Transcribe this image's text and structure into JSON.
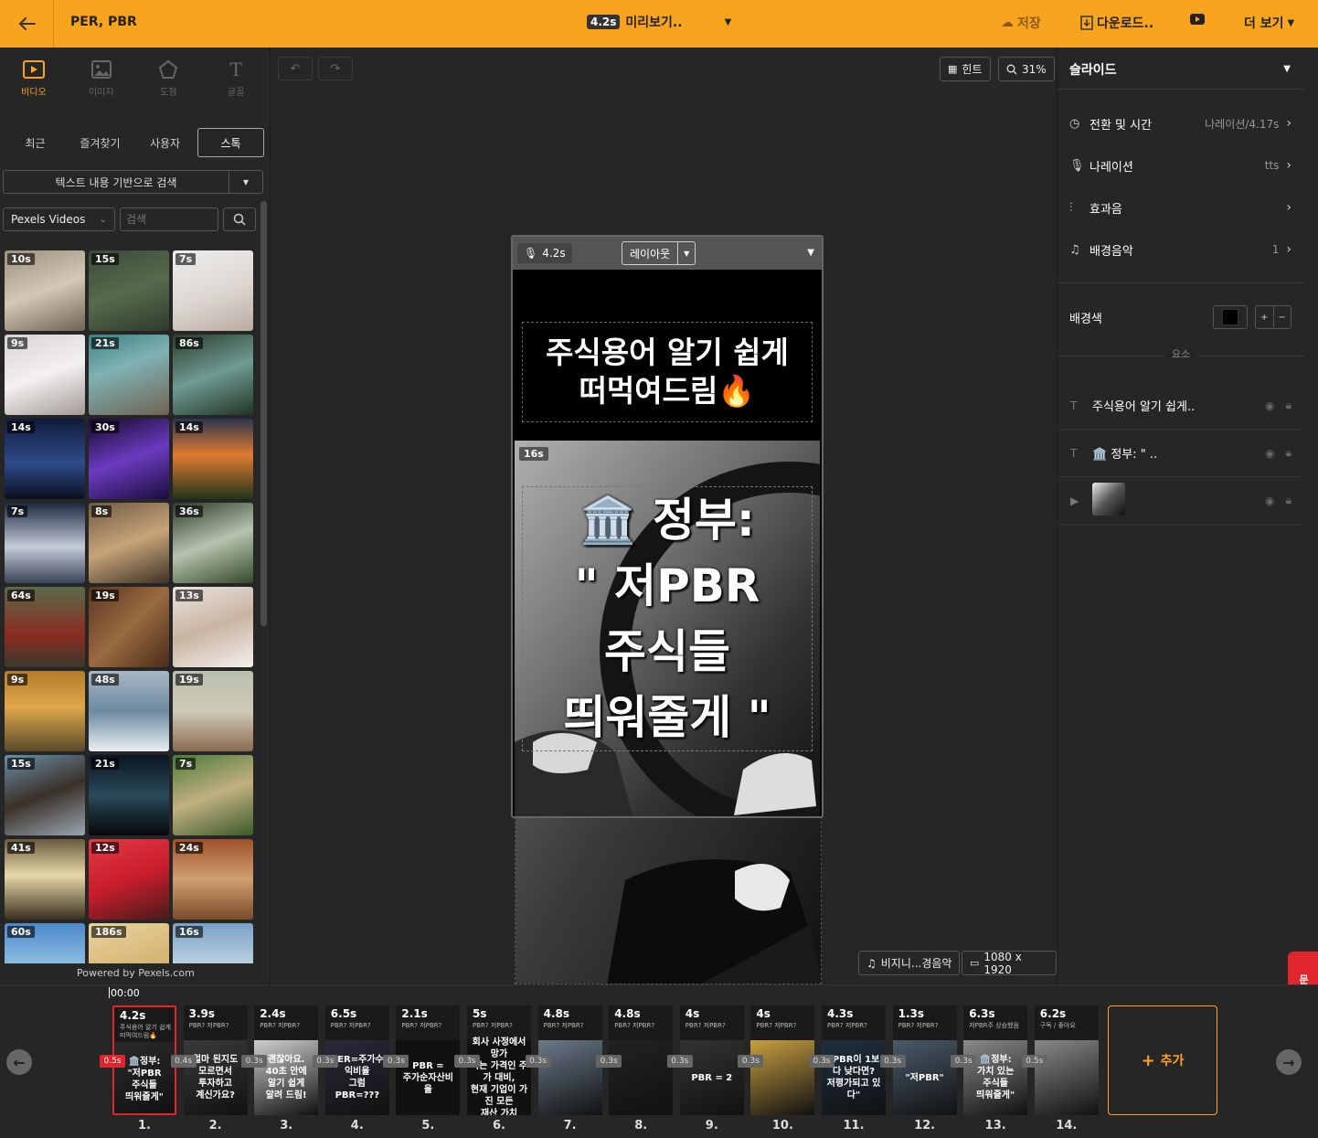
{
  "topbar": {
    "project_title": "PER, PBR",
    "preview_duration": "4.2s",
    "preview_label": "미리보기..",
    "save_label": "저장",
    "download_label": "다운로드..",
    "more_label": "더 보기",
    "accent_color": "#f8a41e"
  },
  "left": {
    "media_tabs": [
      {
        "label": "비디오",
        "icon": "video-icon"
      },
      {
        "label": "이미지",
        "icon": "image-icon"
      },
      {
        "label": "도형",
        "icon": "shape-icon"
      },
      {
        "label": "글꼴",
        "icon": "text-icon"
      }
    ],
    "source_tabs": [
      "최근",
      "즐겨찾기",
      "사용자",
      "스톡"
    ],
    "search_mode": "텍스트 내용 기반으로 검색",
    "provider": "Pexels Videos",
    "search_placeholder": "검색",
    "videos": [
      {
        "dur": "10s",
        "bg": "linear-gradient(160deg,#9b8f7e,#d3c8b5 50%,#6f6455)"
      },
      {
        "dur": "15s",
        "bg": "linear-gradient(160deg,#3b4a3a,#566b4c 50%,#2e3a2c)"
      },
      {
        "dur": "7s",
        "bg": "linear-gradient(160deg,#eeeeee,#dcd6d0 55%,#b9aba0)"
      },
      {
        "dur": "9s",
        "bg": "linear-gradient(160deg,#d9d2d4,#f3f0f0 50%,#a29a96)"
      },
      {
        "dur": "21s",
        "bg": "linear-gradient(160deg,#3d7f84,#7fb2b4 40%,#6e6352)"
      },
      {
        "dur": "86s",
        "bg": "linear-gradient(160deg,#2b3d2c,#6f9a92 50%,#223524)"
      },
      {
        "dur": "14s",
        "bg": "linear-gradient(180deg,#121a3a,#2e4b8a 55%,#0b1020)"
      },
      {
        "dur": "30s",
        "bg": "linear-gradient(160deg,#120a2a,#6b3bc0 50%,#1a0d3a)"
      },
      {
        "dur": "14s",
        "bg": "linear-gradient(180deg,#2a3550,#e07a30 45%,#22351a)"
      },
      {
        "dur": "7s",
        "bg": "linear-gradient(180deg,#1c2740,#c4cbd8 55%,#3a4458)"
      },
      {
        "dur": "8s",
        "bg": "linear-gradient(160deg,#6e5a44,#c7a478 50%,#3e3326)"
      },
      {
        "dur": "36s",
        "bg": "linear-gradient(160deg,#2c3a26,#b7c3b0 50%,#344a2a)"
      },
      {
        "dur": "64s",
        "bg": "linear-gradient(180deg,#5a6b48,#8a2c22 60%,#3a3a2a)"
      },
      {
        "dur": "19s",
        "bg": "linear-gradient(135deg,#5a3620,#9a6a40 50%,#4a2c18)"
      },
      {
        "dur": "13s",
        "bg": "linear-gradient(160deg,#e9e4e0,#c9b4a2 50%,#f4f0ec)"
      },
      {
        "dur": "9s",
        "bg": "linear-gradient(180deg,#b37a2a,#e0a84a 45%,#5a4a2a)"
      },
      {
        "dur": "48s",
        "bg": "linear-gradient(180deg,#a9b7c4,#6c8aa0 50%,#e8eef2)"
      },
      {
        "dur": "19s",
        "bg": "linear-gradient(180deg,#b9c0b0,#cfc9b8 50%,#8a6a50)"
      },
      {
        "dur": "15s",
        "bg": "linear-gradient(160deg,#6a8fa8,#3a3028 50%,#9aa7b0)"
      },
      {
        "dur": "21s",
        "bg": "linear-gradient(180deg,#0a1420,#2a4a5a 50%,#05080c)"
      },
      {
        "dur": "7s",
        "bg": "linear-gradient(160deg,#4a7a3a,#c2b080 50%,#3a5a2a)"
      },
      {
        "dur": "41s",
        "bg": "linear-gradient(180deg,#6a5a40,#e8d8a8 45%,#3a3020)"
      },
      {
        "dur": "12s",
        "bg": "linear-gradient(160deg,#e23a44,#c81e2c 50%,#4a1a1a)"
      },
      {
        "dur": "24s",
        "bg": "linear-gradient(180deg,#a0502a,#d0a070 50%,#7a4a2a)"
      },
      {
        "dur": "60s",
        "bg": "linear-gradient(180deg,#4a88c8,#9ac8e8 60%,#e8eef2)"
      },
      {
        "dur": "186s",
        "bg": "linear-gradient(160deg,#e8d4a0,#d8b878 50%,#c8a060)"
      },
      {
        "dur": "16s",
        "bg": "linear-gradient(180deg,#7aa0c8,#b8d0e0 50%,#4a5a6a)"
      }
    ],
    "powered_by": "Powered by Pexels.com"
  },
  "canvas": {
    "hint_label": "힌트",
    "zoom": "31%",
    "slide_duration": "4.2s",
    "layout_label": "레이아웃",
    "title_text": "주식용어 알기 쉽게\n떠먹여드림🔥",
    "video_duration": "16s",
    "overlay_text": "🏛️ 정부:\n\" 저PBR\n주식들\n띄워줄게 \"",
    "bgm_label": "비지니...경음악",
    "resolution": "1080 x 1920"
  },
  "right": {
    "panel_title": "슬라이드",
    "rows": [
      {
        "icon": "clock-icon",
        "label": "전환 및 시간",
        "value": "나레이션/4.17s"
      },
      {
        "icon": "mic-icon",
        "label": "나레이션",
        "value": "tts"
      },
      {
        "icon": "sound-wave-icon",
        "label": "효과음",
        "value": ""
      },
      {
        "icon": "music-note-icon",
        "label": "배경음악",
        "value": "1"
      }
    ],
    "bg_color_label": "배경색",
    "elements_section": "요소",
    "elements": [
      {
        "type": "T",
        "label": "주식용어 알기 쉽게.."
      },
      {
        "type": "T",
        "label": "🏛️ 정부: \" .."
      },
      {
        "type": "video",
        "label": ""
      }
    ]
  },
  "contact_label": "문의",
  "timeline": {
    "timecode": "00:00",
    "add_label": "추가",
    "slides": [
      {
        "num": "1.",
        "dur": "4.2s",
        "sub": "주식용어 알기 쉽게\n떠먹여드림🔥",
        "text": "🏛️정부:\n\"저PBR\n주식들\n띄워줄게\""
      },
      {
        "num": "2.",
        "dur": "3.9s",
        "sub": "PBR? 저PBR?",
        "text": "얼마 된지도\n모르면서\n투자하고\n계신가요?"
      },
      {
        "num": "3.",
        "dur": "2.4s",
        "sub": "PBR? 저PBR?",
        "text": "괜찮아요.\n40초 안에\n알기 쉽게\n알려 드림!"
      },
      {
        "num": "4.",
        "dur": "6.5s",
        "sub": "PBR? 저PBR?",
        "text": "PER=주가수익비율\n그럼 PBR=???"
      },
      {
        "num": "5.",
        "dur": "2.1s",
        "sub": "PBR? 저PBR?",
        "text": "PBR =\n주가순자산비율"
      },
      {
        "num": "6.",
        "dur": "5s",
        "sub": "PBR? 저PBR?",
        "text": "회사 사정에서 망가\n되는 가격인 주가 대비,\n현재 기업이 가진 모든\n재산 가치"
      },
      {
        "num": "7.",
        "dur": "4.8s",
        "sub": "PBR? 저PBR?",
        "text": ""
      },
      {
        "num": "8.",
        "dur": "4.8s",
        "sub": "PBR? 저PBR?",
        "text": ""
      },
      {
        "num": "9.",
        "dur": "4s",
        "sub": "PBR? 저PBR?",
        "text": "PBR = 2"
      },
      {
        "num": "10.",
        "dur": "4s",
        "sub": "PBR? 저PBR?",
        "text": ""
      },
      {
        "num": "11.",
        "dur": "4.3s",
        "sub": "PBR? 저PBR?",
        "text": "\"PBR이 1보다 낮다면?\n저평가되고 있다\""
      },
      {
        "num": "12.",
        "dur": "1.3s",
        "sub": "PBR? 저PBR?",
        "text": "\"저PBR\""
      },
      {
        "num": "13.",
        "dur": "6.3s",
        "sub": "저PBR주 상승했음",
        "text": "🏛️정부:\n가치 있는\n주식들\n띄워줄게\""
      },
      {
        "num": "14.",
        "dur": "6.2s",
        "sub": "구독 / 좋아요",
        "text": ""
      }
    ],
    "transitions": [
      "0.5s",
      "0.4s",
      "0.3s",
      "0.3s",
      "0.3s",
      "0.3s",
      "0.3s",
      "0.3s",
      "0.3s",
      "0.3s",
      "0.3s",
      "0.3s",
      "0.3s",
      "0.5s"
    ]
  }
}
